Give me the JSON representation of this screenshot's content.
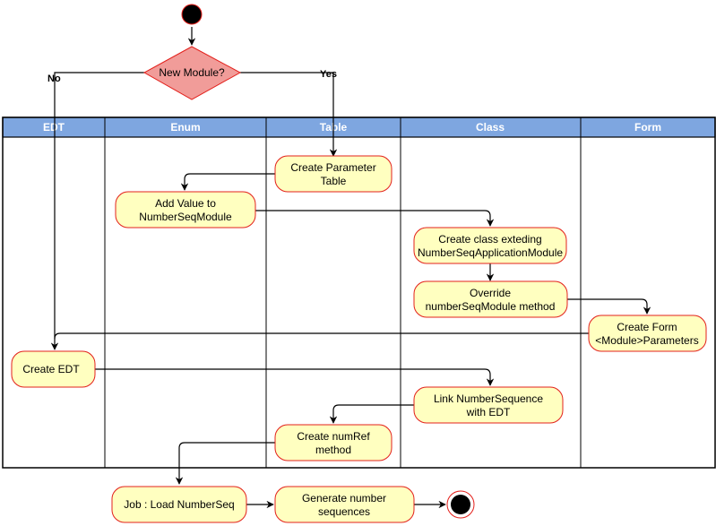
{
  "diagram": {
    "type": "activity-diagram-swimlane",
    "colors": {
      "lane_header": "#7ea6e0",
      "lane_header_text": "#ffffff",
      "action_fill": "#ffffc0",
      "action_stroke": "#e3201b",
      "decision_fill": "#f19c99",
      "decision_stroke": "#e3201b",
      "line": "#000000"
    },
    "lanes": [
      {
        "id": "edt",
        "label": "EDT"
      },
      {
        "id": "enum",
        "label": "Enum"
      },
      {
        "id": "table",
        "label": "Table"
      },
      {
        "id": "class",
        "label": "Class"
      },
      {
        "id": "form",
        "label": "Form"
      }
    ],
    "start": {
      "id": "start",
      "label": "start"
    },
    "decision": {
      "id": "new-module",
      "label": "New Module?",
      "branches": [
        {
          "label": "No",
          "to": "create-edt"
        },
        {
          "label": "Yes",
          "to": "create-parameter-table"
        }
      ]
    },
    "actions": [
      {
        "id": "create-parameter-table",
        "lane": "table",
        "lines": [
          "Create Parameter",
          "Table"
        ]
      },
      {
        "id": "add-value-numberseqmodule",
        "lane": "enum",
        "lines": [
          "Add Value to",
          "NumberSeqModule"
        ]
      },
      {
        "id": "create-class-extending",
        "lane": "class",
        "lines": [
          "Create class exteding",
          "NumberSeqApplicationModule"
        ]
      },
      {
        "id": "override-numberseqmodule",
        "lane": "class",
        "lines": [
          "Override",
          "numberSeqModule method"
        ]
      },
      {
        "id": "create-form-parameters",
        "lane": "form",
        "lines": [
          "Create Form",
          "<Module>Parameters"
        ]
      },
      {
        "id": "create-edt",
        "lane": "edt",
        "lines": [
          "Create EDT"
        ]
      },
      {
        "id": "link-numbersequence",
        "lane": "class",
        "lines": [
          "Link NumberSequence",
          "with EDT"
        ]
      },
      {
        "id": "create-numref",
        "lane": "table",
        "lines": [
          "Create numRef",
          "method"
        ]
      },
      {
        "id": "job-load-numberseq",
        "lane": "",
        "lines": [
          "Job : Load NumberSeq"
        ]
      },
      {
        "id": "generate-number-sequences",
        "lane": "",
        "lines": [
          "Generate number",
          "sequences"
        ]
      }
    ],
    "end": {
      "id": "end",
      "label": "end"
    },
    "flows": [
      {
        "from": "start",
        "to": "new-module"
      },
      {
        "from": "new-module",
        "to": "create-edt",
        "label": "No"
      },
      {
        "from": "new-module",
        "to": "create-parameter-table",
        "label": "Yes"
      },
      {
        "from": "create-parameter-table",
        "to": "add-value-numberseqmodule"
      },
      {
        "from": "add-value-numberseqmodule",
        "to": "create-class-extending"
      },
      {
        "from": "create-class-extending",
        "to": "override-numberseqmodule"
      },
      {
        "from": "override-numberseqmodule",
        "to": "create-form-parameters"
      },
      {
        "from": "create-form-parameters",
        "to": "create-edt"
      },
      {
        "from": "create-edt",
        "to": "link-numbersequence"
      },
      {
        "from": "link-numbersequence",
        "to": "create-numref"
      },
      {
        "from": "create-numref",
        "to": "job-load-numberseq"
      },
      {
        "from": "job-load-numberseq",
        "to": "generate-number-sequences"
      },
      {
        "from": "generate-number-sequences",
        "to": "end"
      }
    ]
  }
}
